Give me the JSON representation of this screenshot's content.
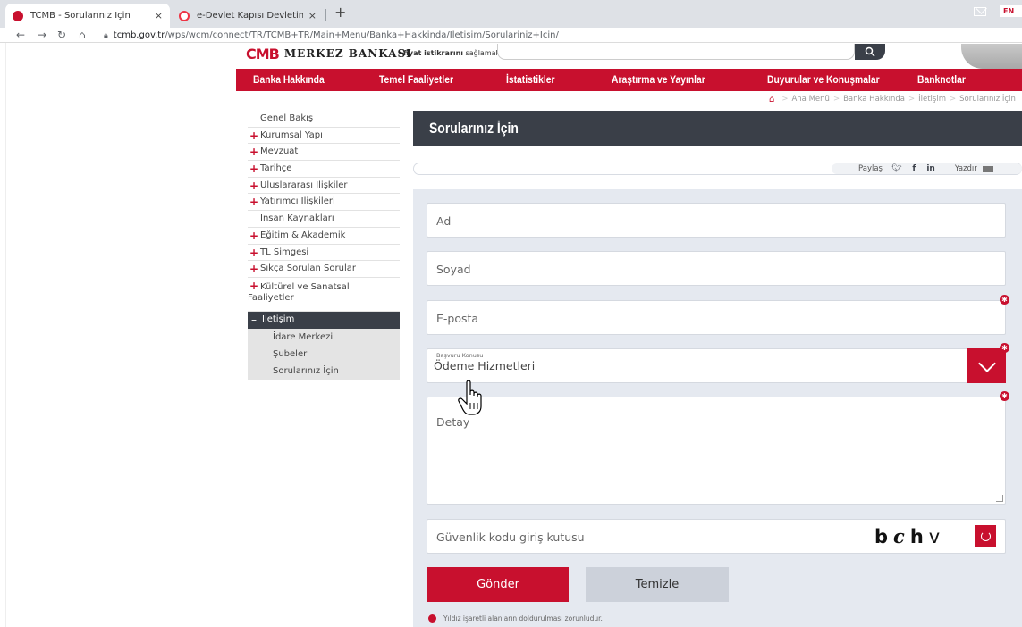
{
  "browser": {
    "tabs": [
      {
        "title": "TCMB - Sorularınız İçin",
        "active": true
      },
      {
        "title": "e-Devlet Kapısı Devletin Kısayolu",
        "active": false
      }
    ],
    "close_glyph": "×",
    "new_tab_glyph": "+",
    "url_host": "tcmb.gov.tr",
    "url_path": "/wps/wcm/connect/TR/TCMB+TR/Main+Menu/Banka+Hakkinda/Iletisim/Sorulariniz+Icin/",
    "icons": [
      "back-icon",
      "forward-icon",
      "reload-icon",
      "home-icon",
      "lock-icon"
    ]
  },
  "header": {
    "logo_mark": "CMB",
    "logo_name": "MERKEZ BANKASI",
    "tagline_bold": "fiyat istikrarını",
    "tagline_rest": " sağlamaktır.",
    "lang": "EN"
  },
  "nav": {
    "items": [
      "Banka Hakkında",
      "Temel Faaliyetler",
      "İstatistikler",
      "Araştırma ve Yayınlar",
      "Duyurular ve Konuşmalar",
      "Banknotlar"
    ]
  },
  "breadcrumb": {
    "items": [
      "Ana Menü",
      "Banka Hakkında",
      "İletişim",
      "Sorularınız İçin"
    ],
    "sep": ">"
  },
  "sidebar": {
    "items": [
      {
        "label": "Genel Bakış",
        "expandable": false
      },
      {
        "label": "Kurumsal Yapı",
        "expandable": true
      },
      {
        "label": "Mevzuat",
        "expandable": true
      },
      {
        "label": "Tarihçe",
        "expandable": true
      },
      {
        "label": "Uluslararası İlişkiler",
        "expandable": true
      },
      {
        "label": "Yatırımcı İlişkileri",
        "expandable": true
      },
      {
        "label": "İnsan Kaynakları",
        "expandable": false
      },
      {
        "label": "Eğitim & Akademik",
        "expandable": true
      },
      {
        "label": "TL Simgesi",
        "expandable": true
      },
      {
        "label": "Sıkça Sorulan Sorular",
        "expandable": true
      },
      {
        "label": "Kültürel ve Sanatsal",
        "label2": "Faaliyetler",
        "expandable": true
      }
    ],
    "active": {
      "label": "İletişim"
    },
    "subitems": [
      "İdare Merkezi",
      "Şubeler",
      "Sorularınız İçin"
    ],
    "plus_glyph": "+",
    "minus_glyph": "–"
  },
  "content": {
    "title": "Sorularınız İçin",
    "share_label": "Paylaş",
    "share_icons": [
      "twitter-icon",
      "facebook-icon",
      "linkedin-icon"
    ],
    "fb_glyph": "f",
    "li_glyph": "in",
    "print_label": "Yazdır"
  },
  "form": {
    "ad_placeholder": "Ad",
    "soyad_placeholder": "Soyad",
    "eposta_placeholder": "E-posta",
    "konu_label": "Başvuru Konusu",
    "konu_value": "Ödeme Hizmetleri",
    "detay_placeholder": "Detay",
    "guvenlik_placeholder": "Güvenlik kodu giriş kutusu",
    "captcha": [
      "b",
      "c",
      "h",
      "v"
    ],
    "required_glyph": "✱",
    "submit_label": "Gönder",
    "clear_label": "Temizle",
    "footnote": "Yıldız işaretli alanların doldurulması zorunludur."
  },
  "colors": {
    "brand_red": "#c8102e",
    "dark_slate": "#3a3f48",
    "panel": "#e5e9f0"
  }
}
